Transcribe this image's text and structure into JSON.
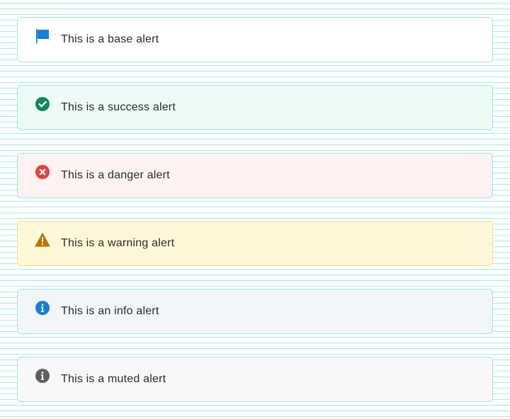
{
  "alerts": [
    {
      "variant": "base",
      "icon": "flag-icon",
      "text": "This is a base alert",
      "icon_color": "#1580d8",
      "background": "#ffffff"
    },
    {
      "variant": "success",
      "icon": "check-circle-icon",
      "text": "This is a success alert",
      "icon_color": "#0f8a5b",
      "background": "#ecfcf4"
    },
    {
      "variant": "danger",
      "icon": "x-circle-icon",
      "text": "This is a danger alert",
      "icon_color": "#e2433a",
      "background": "#fff2f2"
    },
    {
      "variant": "warning",
      "icon": "warning-triangle-icon",
      "text": "This is a warning alert",
      "icon_color": "#b97800",
      "background": "#fff8d6"
    },
    {
      "variant": "info",
      "icon": "info-circle-icon",
      "text": "This is an info alert",
      "icon_color": "#1580d8",
      "background": "#f1f6fa"
    },
    {
      "variant": "muted",
      "icon": "info-circle-icon",
      "text": "This is a muted alert",
      "icon_color": "#5f5f5f",
      "background": "#f8f8f8"
    }
  ]
}
